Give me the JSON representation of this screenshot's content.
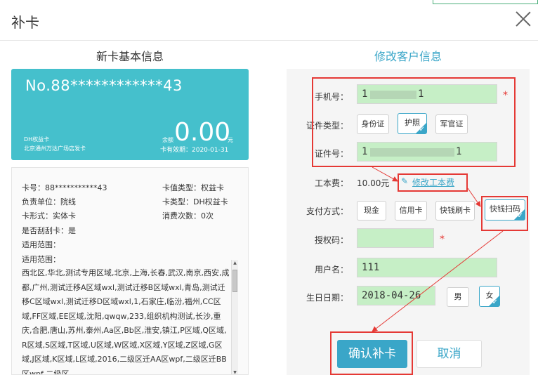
{
  "dialog": {
    "title": "补卡"
  },
  "left": {
    "heading": "新卡基本信息",
    "card": {
      "number": "No.88************43",
      "type": "DH权益卡",
      "shop": "北京通州万达广场店发卡",
      "balance_label": "余额",
      "balance": "0.00",
      "unit": "元",
      "validity": "卡有效期：2020-01-31"
    },
    "info": {
      "card_no": "卡号：88***********43",
      "value_type": "卡值类型：权益卡",
      "owner_unit": "负责单位：院线",
      "card_type": "卡类型：DH权益卡",
      "card_form": "卡形式：实体卡",
      "consume_count": "消费次数：0次",
      "scratch": "是否刮刮卡：是",
      "range_label_1": "适用范围：",
      "range_label_2": "适用范围：",
      "range_text": "西北区,华北,测试专用区域,北京,上海,长春,武汉,南京,西安,成都,广州,测试迁移A区域wxl,测试迁移B区域wxl,青岛,测试迁移C区域wxl,测试迁移D区域wxl,1,石家庄,临汾,福州,CC区域,FF区域,EE区域,沈阳,qwqw,233,组织机构测试,长沙,重庆,合肥,唐山,苏州,泰州,Aa区,Bb区,淮安,镇江,P区域,Q区域,R区域,S区域,T区域,U区域,W区域,X区域,Y区域,Z区域,G区域,J区域,K区域,L区域,2016,二级区迁AA区wpf,二级区迁BB区wpf,二级区"
    }
  },
  "right": {
    "heading": "修改客户信息",
    "phone": {
      "label": "手机号：",
      "value_start": "1",
      "value_end": "1"
    },
    "id_type": {
      "label": "证件类型：",
      "options": [
        "身份证",
        "护照",
        "军官证"
      ],
      "selected": "护照"
    },
    "id_no": {
      "label": "证件号：",
      "value_start": "1",
      "value_end": "1"
    },
    "fee": {
      "label": "工本费：",
      "value": "10.00元",
      "link": "修改工本费"
    },
    "payment": {
      "label": "支付方式：",
      "options": [
        "现金",
        "信用卡",
        "快钱刷卡",
        "快钱扫码"
      ],
      "selected": "快钱扫码"
    },
    "auth_code": {
      "label": "授权码：",
      "value": ""
    },
    "username": {
      "label": "用户名：",
      "value": "111"
    },
    "birthday": {
      "label": "生日日期：",
      "value": "2018-04-26"
    },
    "gender": {
      "options": [
        "男",
        "女"
      ],
      "selected": "女"
    }
  },
  "actions": {
    "confirm": "确认补卡",
    "cancel": "取消"
  },
  "colors": {
    "accent": "#3aa6c8",
    "input_bg": "#c6efc6",
    "annotation": "#e53935"
  }
}
